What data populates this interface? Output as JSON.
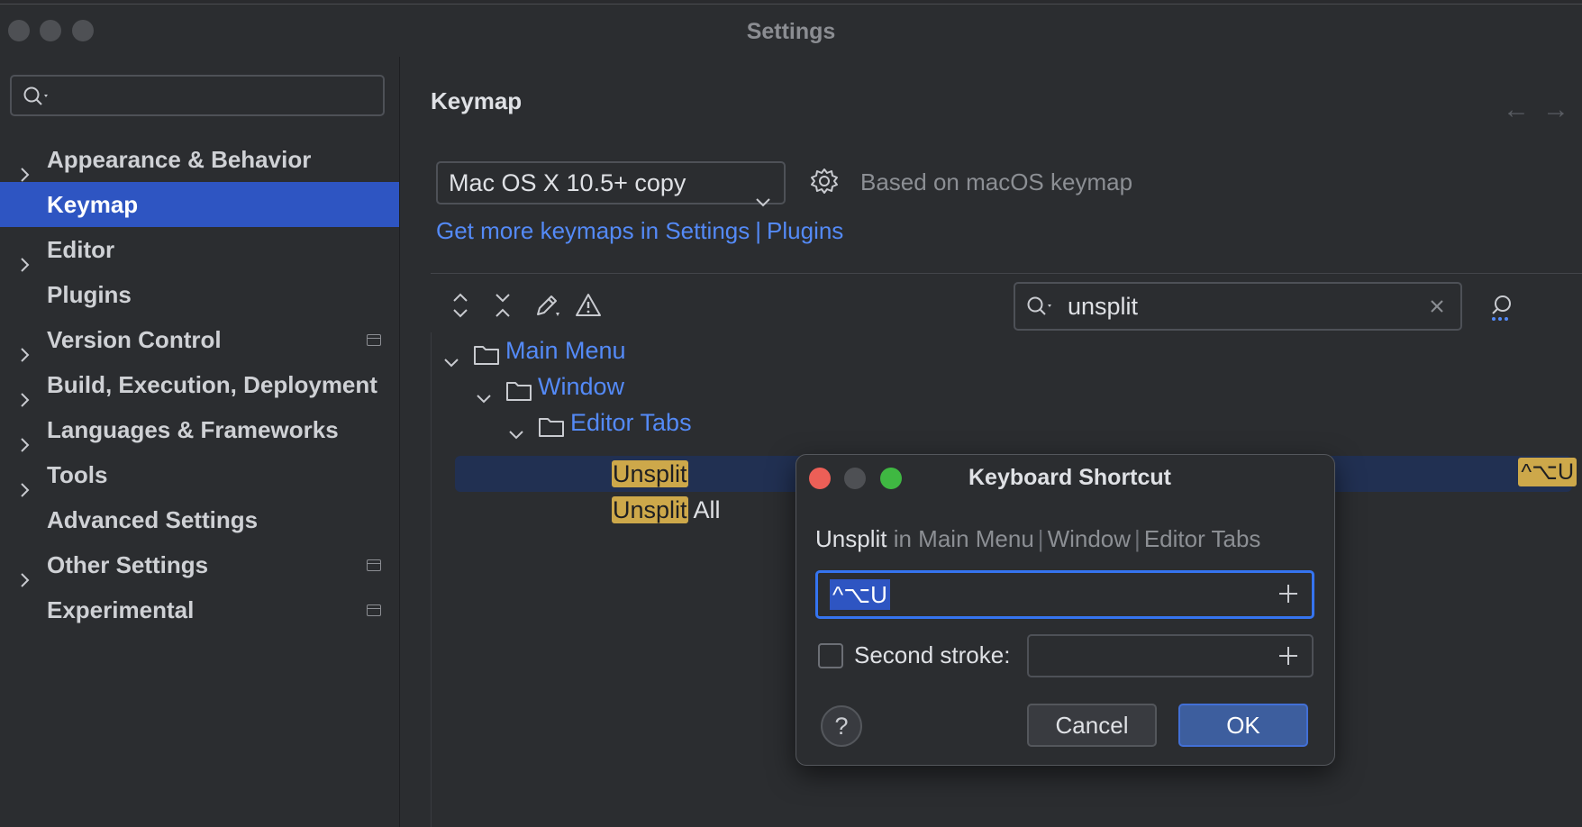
{
  "window": {
    "title": "Settings"
  },
  "sidebar": {
    "search_placeholder": "",
    "items": [
      {
        "label": "Appearance & Behavior",
        "expandable": true,
        "project_icon": false
      },
      {
        "label": "Keymap",
        "expandable": false,
        "selected": true,
        "project_icon": false
      },
      {
        "label": "Editor",
        "expandable": true,
        "project_icon": false
      },
      {
        "label": "Plugins",
        "expandable": false,
        "project_icon": false
      },
      {
        "label": "Version Control",
        "expandable": true,
        "project_icon": true
      },
      {
        "label": "Build, Execution, Deployment",
        "expandable": true,
        "project_icon": false
      },
      {
        "label": "Languages & Frameworks",
        "expandable": true,
        "project_icon": false
      },
      {
        "label": "Tools",
        "expandable": true,
        "project_icon": false
      },
      {
        "label": "Advanced Settings",
        "expandable": false,
        "project_icon": false
      },
      {
        "label": "Other Settings",
        "expandable": true,
        "project_icon": true
      },
      {
        "label": "Experimental",
        "expandable": false,
        "project_icon": true
      }
    ]
  },
  "main": {
    "title": "Keymap",
    "keymap_select": "Mac OS X 10.5+ copy",
    "based_on": "Based on macOS keymap",
    "links": {
      "text": "Get more keymaps in Settings",
      "separator": "|",
      "plugins": "Plugins"
    },
    "filter": {
      "value": "unsplit"
    },
    "tree": {
      "main_menu": "Main Menu",
      "window": "Window",
      "editor_tabs": "Editor Tabs",
      "action1_match": "Unsplit",
      "action1_shortcut": "^⌥U",
      "action2_match": "Unsplit",
      "action2_rest": " All"
    }
  },
  "dialog": {
    "title": "Keyboard Shortcut",
    "action": "Unsplit",
    "path_in": " in Main Menu",
    "path_sep": "|",
    "path_window": "Window",
    "path_tabs": "Editor Tabs",
    "first_stroke": "^⌥U",
    "second_stroke_label": "Second stroke:",
    "second_stroke_value": "",
    "help": "?",
    "cancel": "Cancel",
    "ok": "OK"
  },
  "colors": {
    "accent": "#2e55c2",
    "link": "#548af7",
    "highlight": "#cda84a",
    "close": "#ec5f57",
    "minimize_inactive": "#4e5054",
    "zoom": "#3fb842"
  }
}
